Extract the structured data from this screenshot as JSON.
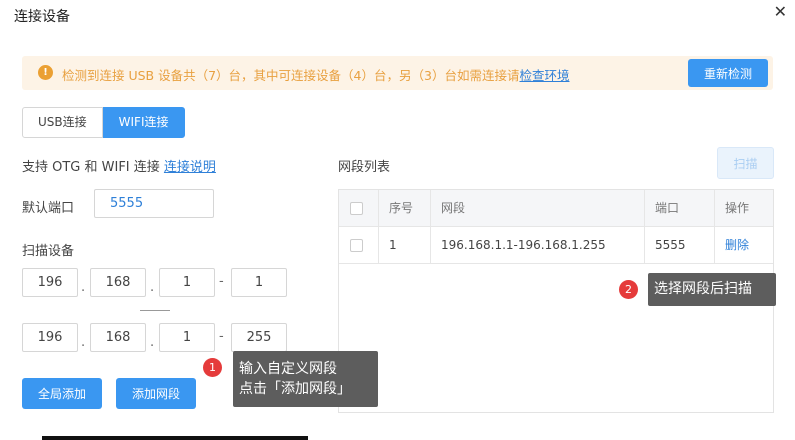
{
  "dialog": {
    "title": "连接设备",
    "close": "✕"
  },
  "warning": {
    "icon": "!",
    "text": "检测到连接 USB 设备共（7）台，其中可连接设备（4）台，另（3）台如需连接请",
    "link": "检查环境",
    "button": "重新检测"
  },
  "tabs": {
    "usb": "USB连接",
    "wifi": "WIFI连接"
  },
  "support": {
    "text": "支持 OTG 和 WIFI 连接 ",
    "link": "连接说明"
  },
  "port": {
    "label": "默认端口",
    "value": "5555"
  },
  "scan": {
    "label": "扫描设备",
    "row1": [
      "196",
      "168",
      "1",
      "1"
    ],
    "row2": [
      "196",
      "168",
      "1",
      "255"
    ],
    "dot": ".",
    "dash": "-"
  },
  "buttons": {
    "all": "全局添加",
    "add": "添加网段",
    "scan": "扫描"
  },
  "segments": {
    "title": "网段列表",
    "headers": [
      "序号",
      "网段",
      "端口",
      "操作"
    ],
    "rows": [
      {
        "index": "1",
        "range": "196.168.1.1-196.168.1.255",
        "port": "5555",
        "action": "删除"
      }
    ]
  },
  "tips": {
    "t1": {
      "badge": "1",
      "line1": "输入自定义网段",
      "line2": "点击「添加网段」"
    },
    "t2": {
      "badge": "2",
      "text": "选择网段后扫描"
    }
  }
}
